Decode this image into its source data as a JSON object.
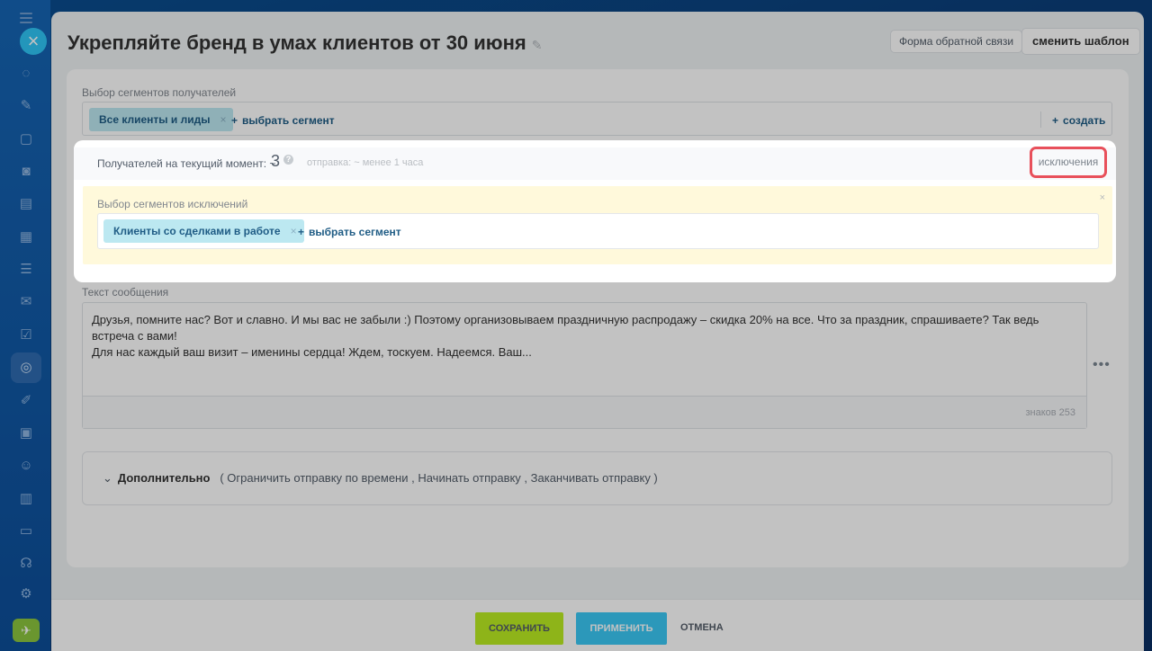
{
  "title": "Укрепляйте бренд в умах клиентов от 30 июня",
  "header": {
    "feedback_form": "Форма обратной связи",
    "change_template": "сменить шаблон"
  },
  "segments": {
    "label": "Выбор сегментов получателей",
    "chips": [
      "Все клиенты и лиды"
    ],
    "add_label": "выбрать сегмент",
    "create_label": "создать"
  },
  "recipients": {
    "label": "Получателей на текущий момент: ~",
    "count": "3",
    "send_time": "отправка: ~ менее 1 часа",
    "exclusions": "исключения"
  },
  "exclusions": {
    "label": "Выбор сегментов исключений",
    "chips": [
      "Клиенты со сделками в работе"
    ],
    "add_label": "выбрать сегмент"
  },
  "message": {
    "label": "Текст сообщения",
    "text_line1": "Друзья, помните нас? Вот и славно. И мы вас не забыли :) Поэтому организовываем праздничную распродажу – скидка 20% на все. Что за праздник, спрашиваете? Так ведь встреча с вами!",
    "text_line2": "Для нас каждый ваш визит – именины сердца! Ждем, тоскуем. Надеемся. Ваш...",
    "char_count": "знаков 253"
  },
  "additional": {
    "title": "Дополнительно",
    "options": "( Ограничить отправку по времени ,  Начинать отправку ,  Заканчивать отправку  )"
  },
  "footer": {
    "save": "СОХРАНИТЬ",
    "apply": "ПРИМЕНИТЬ",
    "cancel": "ОТМЕНА"
  },
  "colors": {
    "highlight_border": "#e8505b",
    "save_button": "#bbed21",
    "apply_button": "#3bc8f5",
    "chip": "#bce8f1",
    "exclusion_area": "#fff9db"
  }
}
